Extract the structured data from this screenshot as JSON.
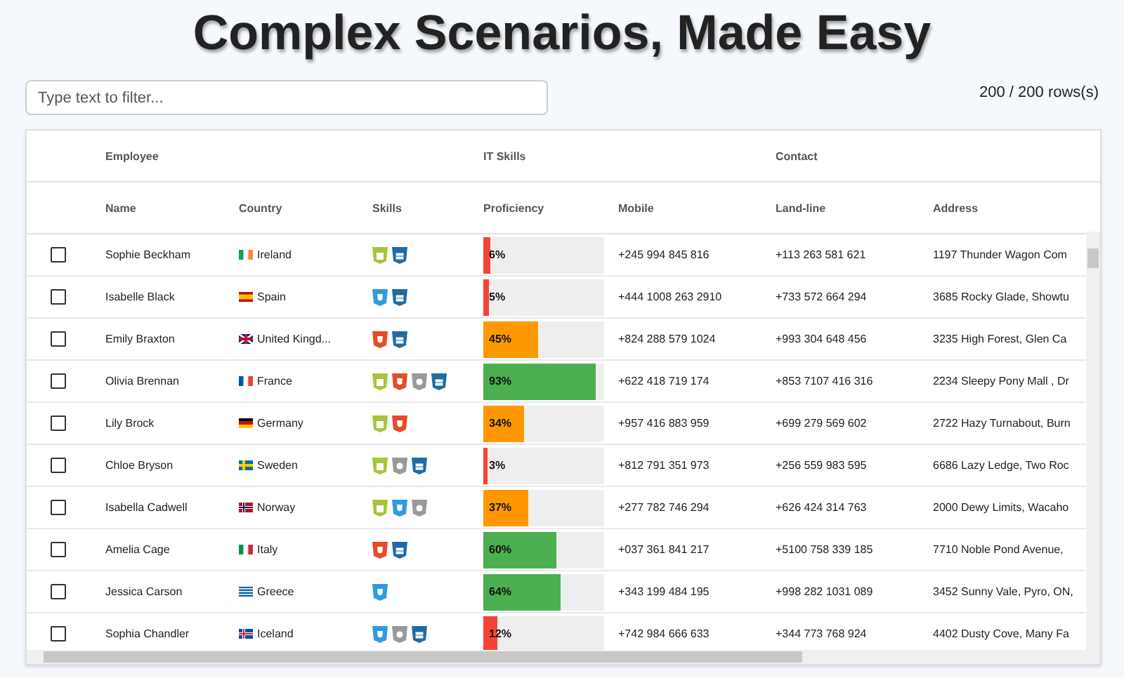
{
  "title": "Complex Scenarios, Made Easy",
  "filter": {
    "placeholder": "Type text to filter..."
  },
  "row_count": "200 / 200 rows(s)",
  "column_groups": [
    {
      "label": "Employee"
    },
    {
      "label": "IT Skills"
    },
    {
      "label": "Contact"
    }
  ],
  "columns": [
    "Name",
    "Country",
    "Skills",
    "Proficiency",
    "Mobile",
    "Land-line",
    "Address"
  ],
  "rows": [
    {
      "checked": false,
      "name": "Sophie Beckham",
      "country": {
        "kind": "ireland",
        "label": "Ireland"
      },
      "skills": [
        {
          "kind": "android"
        },
        {
          "kind": "windows"
        }
      ],
      "proficiency": {
        "level": 0.06,
        "label": "6%"
      },
      "mobile": "+245 994 845 816",
      "landline": "+113 263 581 621",
      "address": "1197 Thunder Wagon Com"
    },
    {
      "checked": false,
      "name": "Isabelle Black",
      "country": {
        "kind": "spain",
        "label": "Spain"
      },
      "skills": [
        {
          "kind": "css"
        },
        {
          "kind": "windows"
        }
      ],
      "proficiency": {
        "level": 0.05,
        "label": "5%"
      },
      "mobile": "+444 1008 263 2910",
      "landline": "+733 572 664 294",
      "address": "3685 Rocky Glade, Showtu"
    },
    {
      "checked": false,
      "name": "Emily Braxton",
      "country": {
        "kind": "uk",
        "label": "United Kingd..."
      },
      "skills": [
        {
          "kind": "html"
        },
        {
          "kind": "windows"
        }
      ],
      "proficiency": {
        "level": 0.45,
        "label": "45%"
      },
      "mobile": "+824 288 579 1024",
      "landline": "+993 304 648 456",
      "address": "3235 High Forest, Glen Ca"
    },
    {
      "checked": false,
      "name": "Olivia Brennan",
      "country": {
        "kind": "france",
        "label": "France"
      },
      "skills": [
        {
          "kind": "android"
        },
        {
          "kind": "html"
        },
        {
          "kind": "apple"
        },
        {
          "kind": "windows"
        }
      ],
      "proficiency": {
        "level": 0.93,
        "label": "93%"
      },
      "mobile": "+622 418 719 174",
      "landline": "+853 7107 416 316",
      "address": "2234 Sleepy Pony Mall , Dr"
    },
    {
      "checked": false,
      "name": "Lily Brock",
      "country": {
        "kind": "germany",
        "label": "Germany"
      },
      "skills": [
        {
          "kind": "android"
        },
        {
          "kind": "html"
        }
      ],
      "proficiency": {
        "level": 0.34,
        "label": "34%"
      },
      "mobile": "+957 416 883 959",
      "landline": "+699 279 569 602",
      "address": "2722 Hazy Turnabout, Burn"
    },
    {
      "checked": false,
      "name": "Chloe Bryson",
      "country": {
        "kind": "sweden",
        "label": "Sweden"
      },
      "skills": [
        {
          "kind": "android"
        },
        {
          "kind": "apple"
        },
        {
          "kind": "windows"
        }
      ],
      "proficiency": {
        "level": 0.03,
        "label": "3%"
      },
      "mobile": "+812 791 351 973",
      "landline": "+256 559 983 595",
      "address": "6686 Lazy Ledge, Two Roc"
    },
    {
      "checked": false,
      "name": "Isabella Cadwell",
      "country": {
        "kind": "norway",
        "label": "Norway"
      },
      "skills": [
        {
          "kind": "android"
        },
        {
          "kind": "css"
        },
        {
          "kind": "apple"
        }
      ],
      "proficiency": {
        "level": 0.37,
        "label": "37%"
      },
      "mobile": "+277 782 746 294",
      "landline": "+626 424 314 763",
      "address": "2000 Dewy Limits, Wacaho"
    },
    {
      "checked": false,
      "name": "Amelia Cage",
      "country": {
        "kind": "italy",
        "label": "Italy"
      },
      "skills": [
        {
          "kind": "html"
        },
        {
          "kind": "windows"
        }
      ],
      "proficiency": {
        "level": 0.6,
        "label": "60%"
      },
      "mobile": "+037 361 841 217",
      "landline": "+5100 758 339 185",
      "address": "7710 Noble Pond Avenue,"
    },
    {
      "checked": false,
      "name": "Jessica Carson",
      "country": {
        "kind": "greece",
        "label": "Greece"
      },
      "skills": [
        {
          "kind": "css"
        }
      ],
      "proficiency": {
        "level": 0.64,
        "label": "64%"
      },
      "mobile": "+343 199 484 195",
      "landline": "+998 282 1031 089",
      "address": "3452 Sunny Vale, Pyro, ON,"
    },
    {
      "checked": false,
      "name": "Sophia Chandler",
      "country": {
        "kind": "iceland",
        "label": "Iceland"
      },
      "skills": [
        {
          "kind": "css"
        },
        {
          "kind": "apple"
        },
        {
          "kind": "windows"
        }
      ],
      "proficiency": {
        "level": 0.12,
        "label": "12%"
      },
      "mobile": "+742 984 666 633",
      "landline": "+344 773 768 924",
      "address": "4402 Dusty Cove, Many Fa"
    }
  ]
}
